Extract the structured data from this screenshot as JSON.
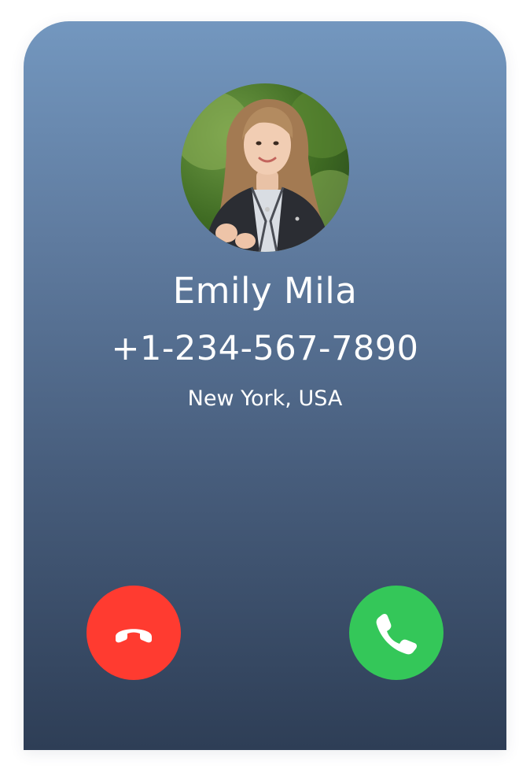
{
  "caller": {
    "name": "Emily Mila",
    "phone_number": "+1-234-567-7890",
    "location": "New York, USA",
    "avatar_icon": "caller-photo"
  },
  "actions": {
    "decline": {
      "icon": "phone-hangup-icon",
      "color": "#ff3b30"
    },
    "accept": {
      "icon": "phone-icon",
      "color": "#34c759"
    }
  },
  "theme": {
    "background_top": "#7397bf",
    "background_bottom": "#2e3e56",
    "text": "#ffffff"
  }
}
